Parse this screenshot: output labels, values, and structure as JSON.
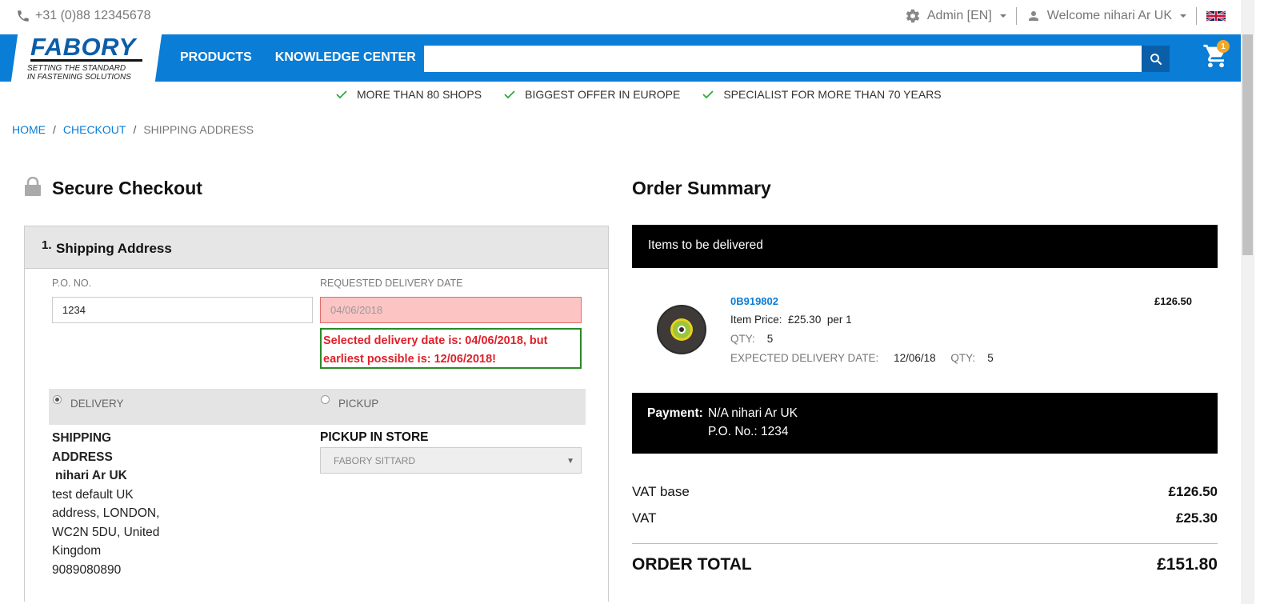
{
  "topbar": {
    "phone": "+31 (0)88 12345678",
    "admin_label": "Admin [EN]",
    "welcome_label": "Welcome nihari Ar UK"
  },
  "header": {
    "logo_word": "FABORY",
    "logo_tagline_1": "SETTING THE STANDARD",
    "logo_tagline_2": "IN FASTENING SOLUTIONS",
    "nav": [
      "PRODUCTS",
      "KNOWLEDGE CENTER"
    ],
    "search_value": "",
    "cart_count": "1",
    "brand_color": "#0a7dd6"
  },
  "usps": [
    "MORE THAN 80 SHOPS",
    "BIGGEST OFFER IN EUROPE",
    "SPECIALIST FOR MORE THAN 70 YEARS"
  ],
  "breadcrumb": {
    "home": "HOME",
    "checkout": "CHECKOUT",
    "current": "SHIPPING ADDRESS"
  },
  "checkout": {
    "title": "Secure Checkout",
    "step_number": "1.",
    "step_title": "Shipping Address",
    "po_label": "P.O. NO.",
    "po_value": "1234",
    "date_label": "REQUESTED DELIVERY DATE",
    "date_value": "04/06/2018",
    "error_line_1": "Selected delivery date is: 04/06/2018, but",
    "error_line_2": "earliest possible is: 12/06/2018!",
    "delivery_label": "DELIVERY",
    "pickup_label": "PICKUP",
    "selected_mode": "DELIVERY",
    "shipping_heading_1": "SHIPPING",
    "shipping_heading_2": "ADDRESS",
    "addr_name": "nihari Ar UK",
    "addr_line_1": "test default UK",
    "addr_line_2": "address,  LONDON,",
    "addr_line_3": "WC2N 5DU,  United",
    "addr_line_4": "Kingdom",
    "addr_phone": "9089080890",
    "pickup_heading": "PICKUP IN STORE",
    "store_value": "FABORY SITTARD"
  },
  "summary": {
    "title": "Order Summary",
    "items_header": "Items to be delivered",
    "item": {
      "sku": "0B919802",
      "line_total": "£126.50",
      "item_price_label": "Item Price:",
      "item_price_value": "£25.30",
      "item_price_unit": "per 1",
      "qty_label": "QTY:",
      "qty_value": "5",
      "expected_label": "EXPECTED DELIVERY DATE:",
      "expected_value": "12/06/18",
      "expected_qty_label": "QTY:",
      "expected_qty_value": "5"
    },
    "payment_label": "Payment:",
    "payment_value": "N/A nihari Ar UK",
    "payment_po": "P.O. No.: 1234",
    "vat_base_label": "VAT base",
    "vat_base_value": "£126.50",
    "vat_label": "VAT",
    "vat_value": "£25.30",
    "total_label": "ORDER TOTAL",
    "total_value": "£151.80"
  }
}
